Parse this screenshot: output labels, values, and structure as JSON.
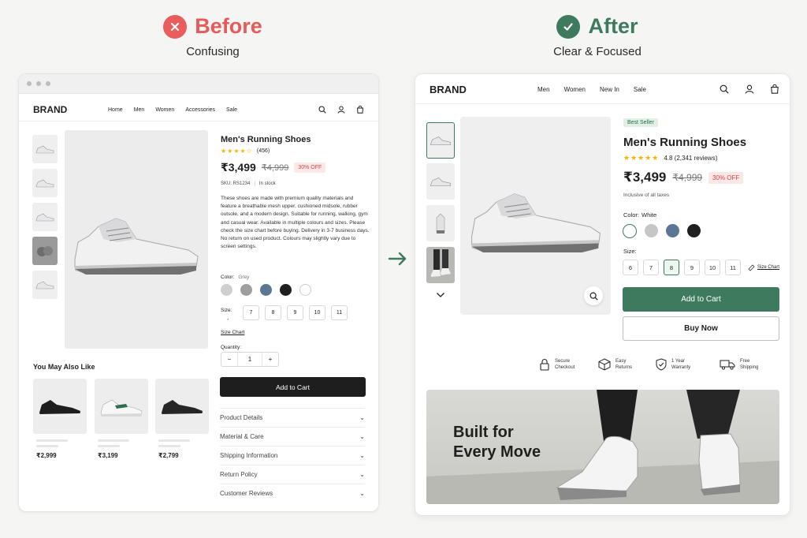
{
  "before": {
    "title": "Before",
    "subtitle": "Confusing",
    "color": "#e85a5a"
  },
  "after": {
    "title": "After",
    "subtitle": "Clear & Focused",
    "color": "#3d7a5e"
  },
  "left": {
    "brand": "BRAND",
    "nav": [
      "Home",
      "Men",
      "Women",
      "Accessories",
      "Sale"
    ],
    "title": "Men's Running Shoes",
    "rating_count": "(456)",
    "price": "₹3,499",
    "old_price": "₹4,999",
    "discount": "30% OFF",
    "sku": "SKU: RS1234",
    "sep": "|",
    "stock": "In stock",
    "description": "These shoes are made with premium quality materials and feature a breathable mesh upper, cushioned midsole, rubber outsole, and a modern design. Suitable for running, walking, gym and casual wear. Available in multiple colours and sizes. Please check the size chart before buying. Delivery in 3-7 business days. No return on used product. Colours may slightly vary due to screen settings.",
    "color_label": "Color:",
    "color_extra": "Grey",
    "size_label": "Size:",
    "sizes": [
      "7",
      "8",
      "9",
      "10",
      "11"
    ],
    "size_chart": "Size Chart",
    "quantity_label": "Quantity:",
    "qty_minus": "−",
    "qty": "1",
    "qty_plus": "+",
    "add_to_cart": "Add to Cart",
    "accordion": [
      "Product Details",
      "Material & Care",
      "Shipping Information",
      "Return Policy",
      "Customer Reviews"
    ],
    "also_like": "You May Also Like",
    "rec_prices": [
      "₹2,999",
      "₹3,199",
      "₹2,799"
    ]
  },
  "right": {
    "brand": "BRAND",
    "nav": [
      "Men",
      "Women",
      "New In",
      "Sale"
    ],
    "badge": "Best Seller",
    "title": "Men's Running Shoes",
    "rating": "4.8 (2,341 reviews)",
    "price": "₹3,499",
    "old_price": "₹4,999",
    "discount": "30% OFF",
    "tax_note": "Inclusive of all taxes",
    "color_label": "Color:",
    "color_value": "White",
    "size_label": "Size:",
    "sizes": [
      "6",
      "7",
      "8",
      "9",
      "10",
      "11"
    ],
    "selected_size": "8",
    "size_chart": "Size Chart",
    "add_to_cart": "Add to Cart",
    "buy_now": "Buy Now",
    "trust": [
      {
        "line1": "Secure",
        "line2": "Checkout",
        "icon": "lock-icon"
      },
      {
        "line1": "Easy",
        "line2": "Returns",
        "icon": "box-icon"
      },
      {
        "line1": "1 Year",
        "line2": "Warranty",
        "icon": "shield-icon"
      },
      {
        "line1": "Free",
        "line2": "Shipping",
        "icon": "truck-icon"
      }
    ],
    "banner_line1": "Built for",
    "banner_line2": "Every Move",
    "accent": "#3d7a5e"
  }
}
